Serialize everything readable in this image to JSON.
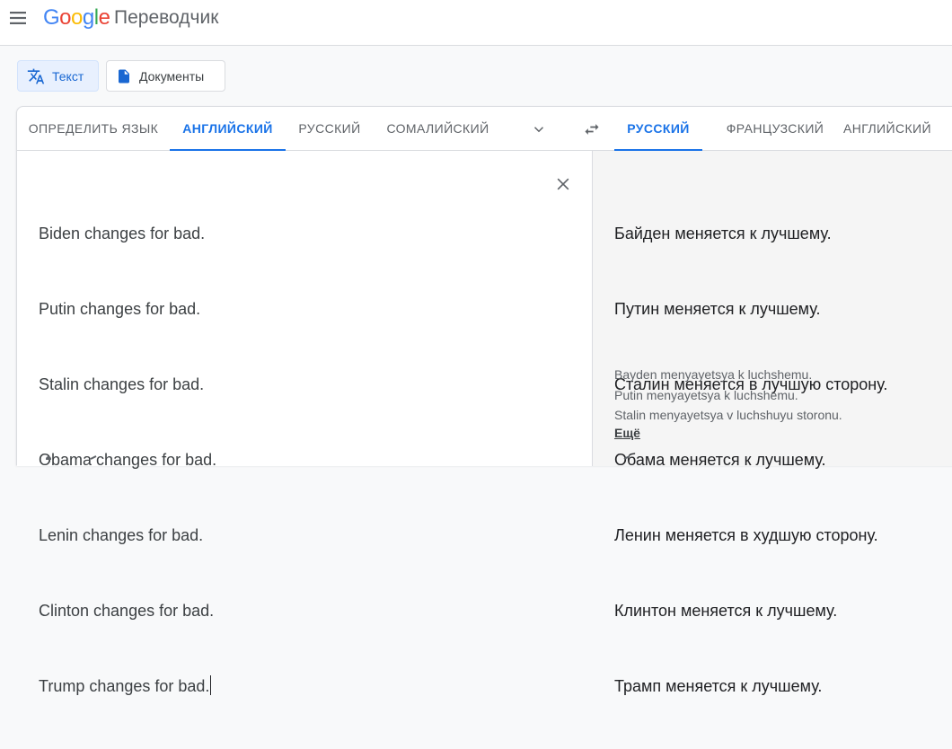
{
  "header": {
    "logo_letters": [
      {
        "char": "G",
        "color": "#4285F4"
      },
      {
        "char": "o",
        "color": "#EA4335"
      },
      {
        "char": "o",
        "color": "#FBBC05"
      },
      {
        "char": "g",
        "color": "#4285F4"
      },
      {
        "char": "l",
        "color": "#34A853"
      },
      {
        "char": "e",
        "color": "#EA4335"
      }
    ],
    "app_name": "Переводчик"
  },
  "modes": {
    "text_label": "Текст",
    "documents_label": "Документы"
  },
  "source_languages": [
    "ОПРЕДЕЛИТЬ ЯЗЫК",
    "АНГЛИЙСКИЙ",
    "РУССКИЙ",
    "СОМАЛИЙСКИЙ"
  ],
  "source_active_index": 1,
  "target_languages": [
    "РУССКИЙ",
    "ФРАНЦУЗСКИЙ",
    "АНГЛИЙСКИЙ"
  ],
  "target_active_index": 0,
  "source_text": [
    "Biden changes for bad.",
    "Putin changes for bad.",
    "Stalin changes for bad.",
    "Obama changes for bad.",
    "Lenin changes for bad.",
    "Clinton changes for bad.",
    "Trump changes for bad."
  ],
  "translation": [
    "Байден меняется к лучшему.",
    "Путин меняется к лучшему.",
    "Сталин меняется в лучшую сторону.",
    "Обама меняется к лучшему.",
    "Ленин меняется в худшую сторону.",
    "Клинтон меняется к лучшему.",
    "Трамп меняется к лучшему."
  ],
  "transliteration": [
    "Bayden menyayetsya k luchshemu.",
    "Putin menyayetsya k luchshemu.",
    "Stalin menyayetsya v luchshuyu storonu."
  ],
  "more_label": "Ещё",
  "colors": {
    "accent": "#1a73e8",
    "mode_active_bg": "#e8f0fe"
  }
}
